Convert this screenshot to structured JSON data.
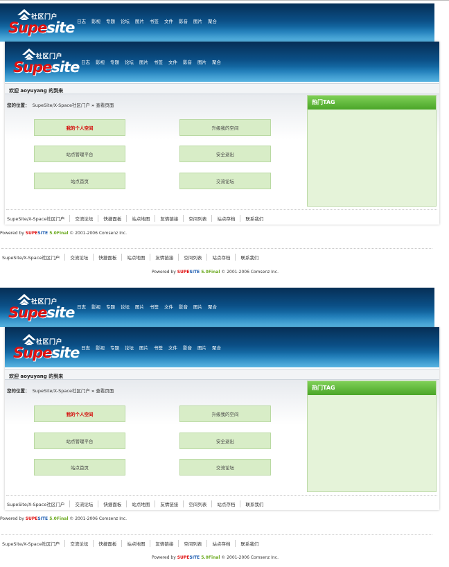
{
  "logo": {
    "chinese_text": "社区门户",
    "word_part1": "Supe",
    "word_part2": "site"
  },
  "nav": {
    "items": [
      {
        "label": "日志"
      },
      {
        "label": "影视"
      },
      {
        "label": "专题"
      },
      {
        "label": "论坛"
      },
      {
        "label": "图片"
      },
      {
        "label": "书签"
      },
      {
        "label": "文件"
      },
      {
        "label": "影音"
      },
      {
        "label": "图片"
      },
      {
        "label": "聚合"
      }
    ]
  },
  "welcome": {
    "text": "欢迎 aoyuyang 的到来"
  },
  "breadcrumb": {
    "prefix": "您的位置：",
    "site": "SupeSite/X-Space社区门户",
    "separator": "»",
    "current": "查看页面"
  },
  "buttons": {
    "my_space": "我的个人空间",
    "upgrade_space": "升级我的空间",
    "admin_platform": "站点管理平台",
    "logout": "安全退出",
    "home": "站点首页",
    "forum": "交流论坛"
  },
  "tag_box": {
    "title": "热门TAG"
  },
  "footer": {
    "links": [
      {
        "label": "SupeSite/X-Space社区门户"
      },
      {
        "label": "交流论坛"
      },
      {
        "label": "快捷面板"
      },
      {
        "label": "站点地图"
      },
      {
        "label": "友情链接"
      },
      {
        "label": "空间列表"
      },
      {
        "label": "站点存档"
      },
      {
        "label": "联系我们"
      }
    ]
  },
  "powered": {
    "prefix": "Powered by ",
    "sup": "SUPE",
    "site": "SITE",
    "version": " 5.0Final",
    "copyright": " © 2001-2006 Comsenz Inc."
  },
  "colors": {
    "banner_dark": "#062e55",
    "banner_light": "#45a7d8",
    "button_green": "#d8edc7",
    "tag_header_green": "#4aa528",
    "highlight_red": "#d40000"
  }
}
